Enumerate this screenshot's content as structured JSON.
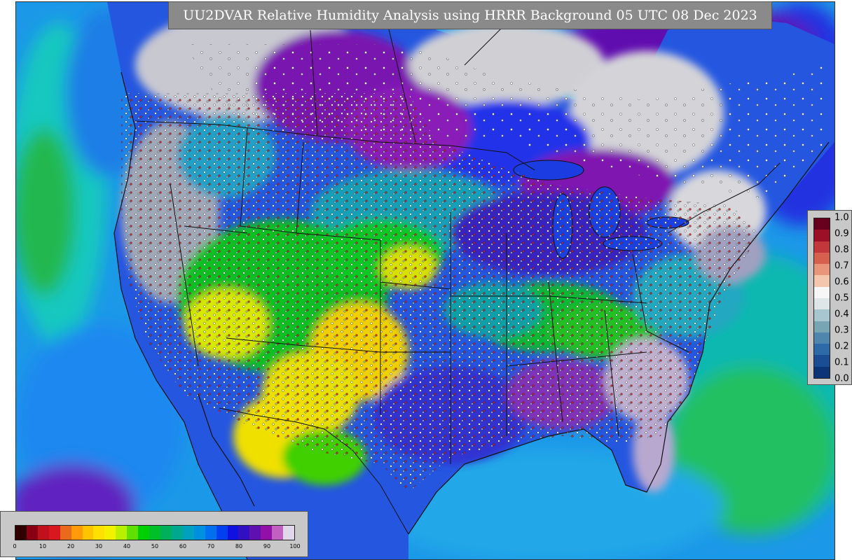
{
  "title": "UU2DVAR Relative Humidity Analysis using HRRR Background 05 UTC 08 Dec 2023",
  "obs_colorbar": {
    "ticks": [
      "1.0",
      "0.9",
      "0.8",
      "0.7",
      "0.6",
      "0.5",
      "0.4",
      "0.3",
      "0.2",
      "0.1",
      "0.0"
    ],
    "colors": [
      "#67001f",
      "#9b1026",
      "#c2373b",
      "#d6604d",
      "#e8957a",
      "#f4c6ad",
      "#f7f7f7",
      "#dfe6e8",
      "#a7c6cf",
      "#78a5b4",
      "#4f86ad",
      "#2f6aa8",
      "#1b4d94",
      "#0b3576"
    ]
  },
  "rh_colorbar": {
    "ticks": [
      "0",
      "10",
      "20",
      "30",
      "40",
      "50",
      "60",
      "70",
      "80",
      "90",
      "100"
    ],
    "colors": [
      "#300000",
      "#8a0012",
      "#c0101a",
      "#d8181e",
      "#e86a1a",
      "#ff9a0a",
      "#ffc400",
      "#ffe000",
      "#f2f200",
      "#b8f000",
      "#60e000",
      "#00d000",
      "#00c02a",
      "#00b05a",
      "#00a890",
      "#00a0c0",
      "#0090e0",
      "#0070f0",
      "#0040f0",
      "#1010e0",
      "#3010c0",
      "#6010b0",
      "#9010a8",
      "#c060c0",
      "#e0d8e8"
    ]
  }
}
